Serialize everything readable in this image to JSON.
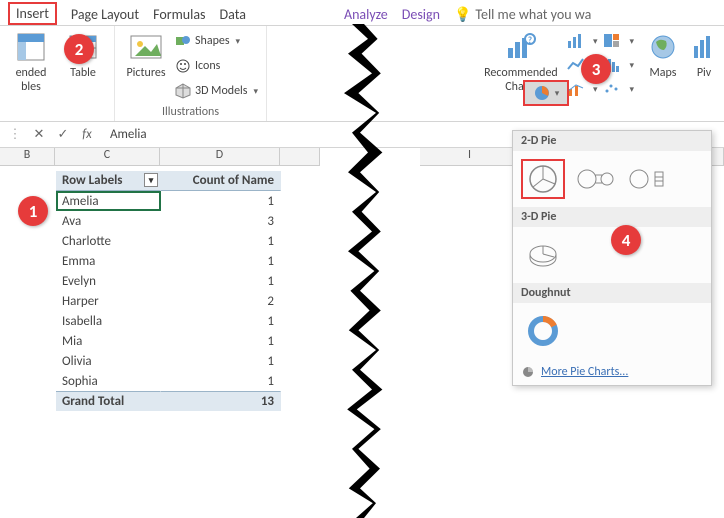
{
  "tabs": {
    "insert": "Insert",
    "page_layout": "Page Layout",
    "formulas": "Formulas",
    "data": "Data",
    "analyze": "Analyze",
    "design": "Design",
    "tell": "Tell me what you wa"
  },
  "ribbon": {
    "left": {
      "ended_bles": "ended\nbles",
      "table": "Table",
      "pictures": "Pictures",
      "shapes": "Shapes",
      "icons": "Icons",
      "models": "3D Models",
      "ill_group": "Illustrations"
    },
    "right": {
      "rec_charts": "Recommended\nCharts",
      "maps": "Maps",
      "piv": "Piv"
    }
  },
  "formula_bar": {
    "cancel": "✕",
    "enter": "✓",
    "fx": "fx",
    "value": "Amelia"
  },
  "columns": {
    "b": "B",
    "c": "C",
    "d": "D",
    "i": "I"
  },
  "pivot": {
    "h1": "Row Labels",
    "h2": "Count of Name",
    "rows": [
      {
        "label": "Amelia",
        "val": "1"
      },
      {
        "label": "Ava",
        "val": "3"
      },
      {
        "label": "Charlotte",
        "val": "1"
      },
      {
        "label": "Emma",
        "val": "1"
      },
      {
        "label": "Evelyn",
        "val": "1"
      },
      {
        "label": "Harper",
        "val": "2"
      },
      {
        "label": "Isabella",
        "val": "1"
      },
      {
        "label": "Mia",
        "val": "1"
      },
      {
        "label": "Olivia",
        "val": "1"
      },
      {
        "label": "Sophia",
        "val": "1"
      }
    ],
    "total_l": "Grand Total",
    "total_v": "13"
  },
  "pie_menu": {
    "s2d": "2-D Pie",
    "s3d": "3-D Pie",
    "dough": "Doughnut",
    "more": "More Pie Charts..."
  },
  "callouts": {
    "c1": "1",
    "c2": "2",
    "c3": "3",
    "c4": "4"
  }
}
